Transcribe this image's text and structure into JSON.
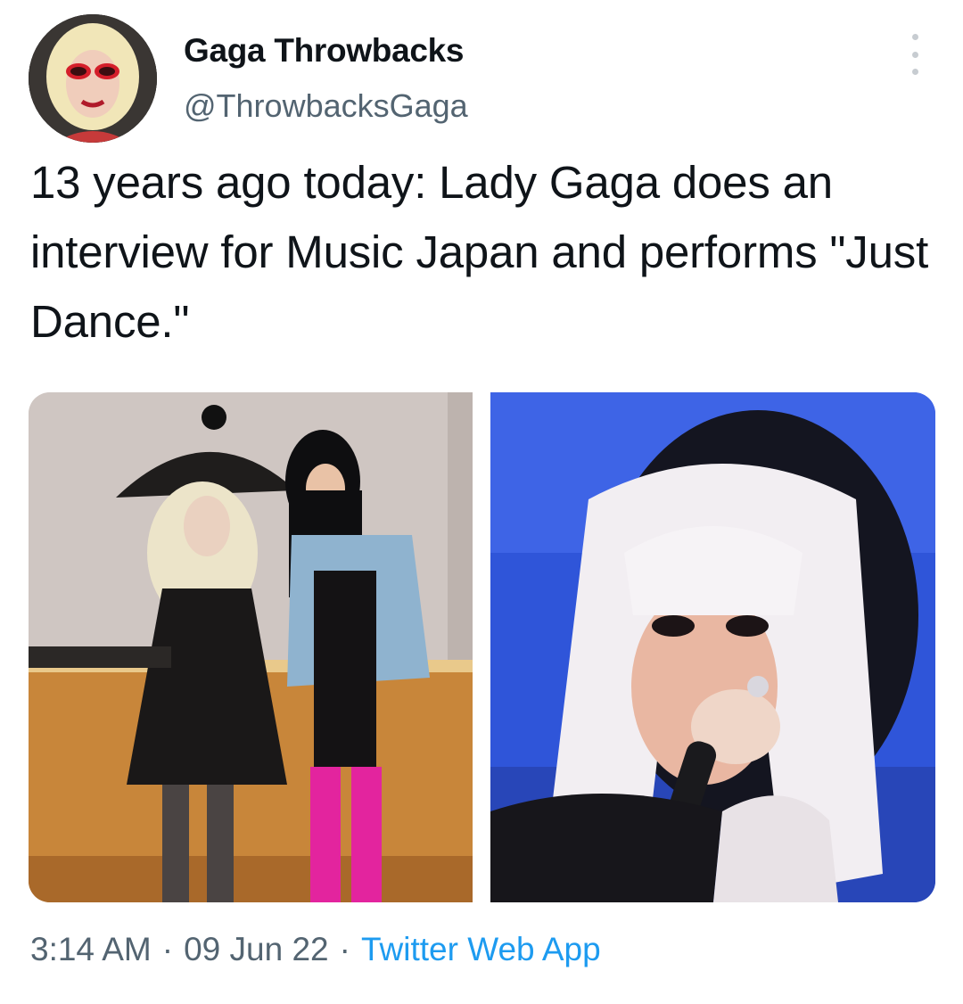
{
  "tweet": {
    "author": {
      "display_name": "Gaga Throwbacks",
      "handle": "@ThrowbacksGaga",
      "avatar_icon": "avatar-icon"
    },
    "text": "13 years ago today: Lady Gaga does an interview for Music Japan and performs \"Just Dance.\"",
    "media": [
      {
        "kind": "photo",
        "icon": "photo-icon"
      },
      {
        "kind": "photo",
        "icon": "photo-icon"
      }
    ],
    "meta": {
      "time": "3:14 AM",
      "separator": "·",
      "date": "09 Jun 22",
      "source": "Twitter Web App"
    },
    "more_icon": "more-icon"
  },
  "colors": {
    "text_primary": "#0f1419",
    "text_secondary": "#536471",
    "accent": "#1d9bf0"
  }
}
